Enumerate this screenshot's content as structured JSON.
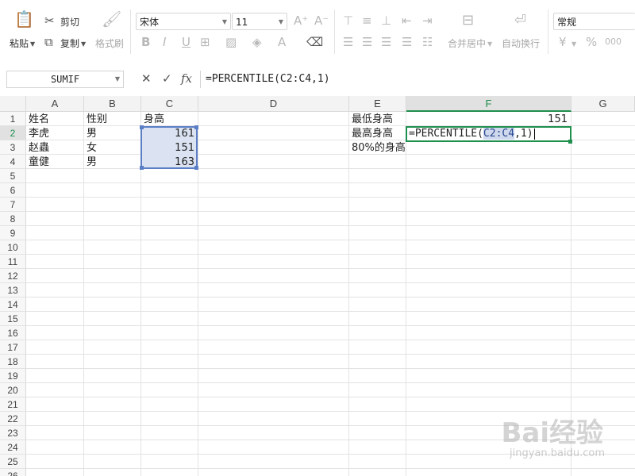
{
  "toolbar": {
    "paste_label": "粘贴",
    "cut_label": "剪切",
    "copy_label": "复制",
    "format_painter_label": "格式刷",
    "font_name": "宋体",
    "font_size": "11",
    "bold": "B",
    "italic": "I",
    "underline": "U",
    "merge_center_label": "合并居中",
    "wrap_text_label": "自动换行",
    "number_format": "常规",
    "currency_symbol": "¥",
    "percent_symbol": "%",
    "thousands_symbol": "000"
  },
  "formula_bar": {
    "name_box": "SUMIF",
    "fx": "fx",
    "formula": "=PERCENTILE(C2:C4,1)"
  },
  "columns": [
    "A",
    "B",
    "C",
    "D",
    "E",
    "F",
    "G"
  ],
  "rows": [
    "1",
    "2",
    "3",
    "4",
    "5",
    "6",
    "7",
    "8",
    "9",
    "10",
    "11",
    "12",
    "13",
    "14",
    "15",
    "16",
    "17",
    "18",
    "19",
    "20",
    "21",
    "22",
    "23",
    "24",
    "25",
    "26"
  ],
  "cells": {
    "A1": "姓名",
    "B1": "性别",
    "C1": "身高",
    "A2": "李虎",
    "B2": "男",
    "C2": "161",
    "A3": "赵蟲",
    "B3": "女",
    "C3": "151",
    "A4": "童健",
    "B4": "男",
    "C4": "163",
    "E1": "最低身高",
    "F1": "151",
    "E2": "最高身高",
    "E3": "80%的身高"
  },
  "editing": {
    "prefix": "=PERCENTILE(",
    "ref": "C2:C4",
    "suffix": ",1)"
  },
  "watermark": {
    "brand": "Bai经验",
    "url": "jingyan.baidu.com"
  },
  "colors": {
    "accent": "#1f8f4e",
    "range_fill": "#dbe3f2",
    "range_border": "#5b7ec5"
  }
}
